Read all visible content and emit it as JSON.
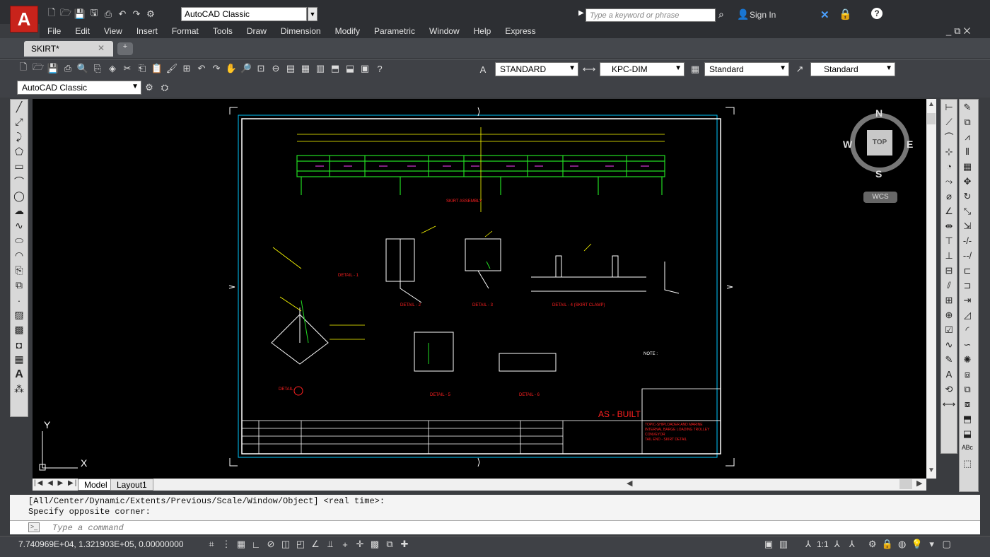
{
  "app": {
    "logo_letter": "A",
    "workspace": "AutoCAD Classic"
  },
  "search": {
    "placeholder": "Type a keyword or phrase"
  },
  "user": {
    "sign_in": "Sign In"
  },
  "menu": [
    "File",
    "Edit",
    "View",
    "Insert",
    "Format",
    "Tools",
    "Draw",
    "Dimension",
    "Modify",
    "Parametric",
    "Window",
    "Help",
    "Express"
  ],
  "document_tab": {
    "label": "SKIRT*"
  },
  "styles": {
    "text_style": "STANDARD",
    "dim_style": "KPC-DIM",
    "table_style": "Standard",
    "mleader_style": "Standard"
  },
  "workspace_dropdown": "AutoCAD Classic",
  "viewcube": {
    "north": "N",
    "south": "S",
    "east": "E",
    "west": "W",
    "face": "TOP",
    "ucs": "WCS"
  },
  "drawing": {
    "title": "SKIRT ASSEMBLY",
    "details": [
      "DETAIL - 1",
      "DETAIL - 2",
      "DETAIL - 3",
      "DETAIL - 4 (SKIRT CLAMP)",
      "DETAIL - 5",
      "DETAIL - 6",
      "DETAIL"
    ],
    "stamp": "AS - BUILT",
    "note_header": "NOTE :",
    "title_block": [
      "TOPIC-SHIPLOADER AND MARINE",
      "INTERNAL BARGE LOADING TROLLEY",
      "CONVEYOR",
      "TAIL END - SKIRT DETAIL"
    ],
    "ucs_x": "X",
    "ucs_y": "Y"
  },
  "layout_tabs": [
    "Model",
    "Layout1"
  ],
  "command_history": [
    "[All/Center/Dynamic/Extents/Previous/Scale/Window/Object] <real time>:",
    "Specify opposite corner:"
  ],
  "command_prompt": "Type a command",
  "status": {
    "coordinates": "7.740969E+04, 1.321903E+05, 0.00000000",
    "scale": "1:1"
  },
  "colors": {
    "background": "#000000",
    "drawing_green": "#22dd22",
    "drawing_red": "#ff2020",
    "drawing_yellow": "#ffff00",
    "drawing_white": "#ffffff",
    "border_cyan": "#00c8ff"
  }
}
